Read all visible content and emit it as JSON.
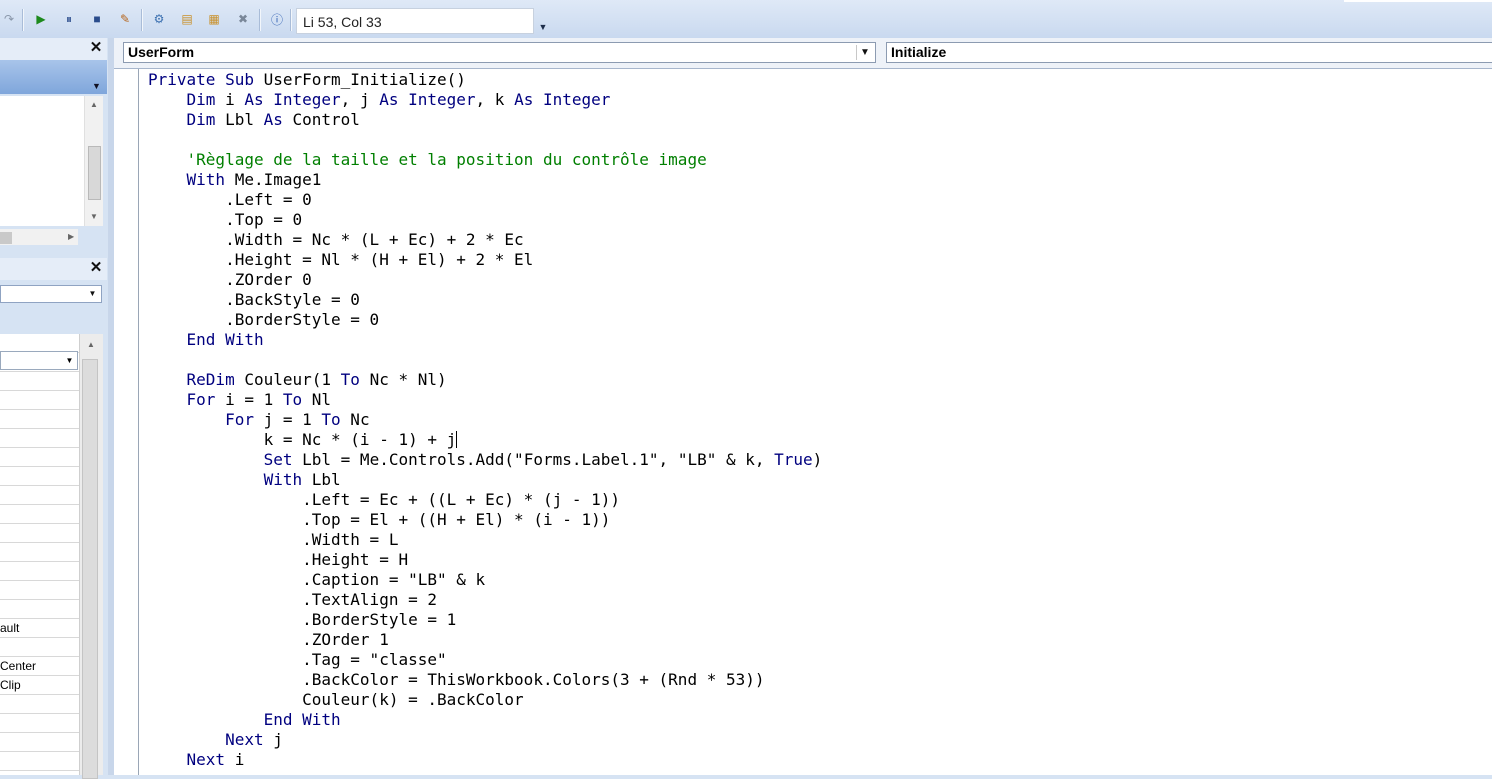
{
  "toolbar": {
    "icons": [
      "redo-icon",
      "run-icon",
      "pause-icon",
      "stop-icon",
      "design-mode-icon",
      "project-explorer-icon",
      "properties-window-icon",
      "object-browser-icon",
      "toolbox-icon",
      "help-icon"
    ],
    "cursor_position": "Li 53, Col 33"
  },
  "left_panel": {
    "property_rows": [
      "",
      "",
      "",
      "",
      "",
      "",
      "",
      "",
      "",
      "",
      "",
      "",
      "",
      "",
      "",
      "ault",
      "",
      "Center",
      "Clip",
      "",
      "",
      "",
      ""
    ]
  },
  "code_window": {
    "object_combo": "UserForm",
    "procedure_combo": "Initialize",
    "lines": [
      [
        [
          "Private Sub",
          "kw"
        ],
        [
          " UserForm_Initialize()",
          ""
        ]
      ],
      [
        [
          "    ",
          ""
        ],
        [
          "Dim",
          "kw"
        ],
        [
          " i ",
          ""
        ],
        [
          "As Integer",
          "kw"
        ],
        [
          ", j ",
          ""
        ],
        [
          "As Integer",
          "kw"
        ],
        [
          ", k ",
          ""
        ],
        [
          "As Integer",
          "kw"
        ]
      ],
      [
        [
          "    ",
          ""
        ],
        [
          "Dim",
          "kw"
        ],
        [
          " Lbl ",
          ""
        ],
        [
          "As",
          "kw"
        ],
        [
          " Control",
          ""
        ]
      ],
      [
        [
          "",
          ""
        ]
      ],
      [
        [
          "    ",
          ""
        ],
        [
          "'Règlage de la taille et la position du contrôle image",
          "cm"
        ]
      ],
      [
        [
          "    ",
          ""
        ],
        [
          "With",
          "kw"
        ],
        [
          " Me.Image1",
          ""
        ]
      ],
      [
        [
          "        .Left = 0",
          ""
        ]
      ],
      [
        [
          "        .Top = 0",
          ""
        ]
      ],
      [
        [
          "        .Width = Nc * (L + Ec) + 2 * Ec",
          ""
        ]
      ],
      [
        [
          "        .Height = Nl * (H + El) + 2 * El",
          ""
        ]
      ],
      [
        [
          "        .ZOrder 0",
          ""
        ]
      ],
      [
        [
          "        .BackStyle = 0",
          ""
        ]
      ],
      [
        [
          "        .BorderStyle = 0",
          ""
        ]
      ],
      [
        [
          "    ",
          ""
        ],
        [
          "End With",
          "kw"
        ]
      ],
      [
        [
          "",
          ""
        ]
      ],
      [
        [
          "    ",
          ""
        ],
        [
          "ReDim",
          "kw"
        ],
        [
          " Couleur(1 ",
          ""
        ],
        [
          "To",
          "kw"
        ],
        [
          " Nc * Nl)",
          ""
        ]
      ],
      [
        [
          "    ",
          ""
        ],
        [
          "For",
          "kw"
        ],
        [
          " i = 1 ",
          ""
        ],
        [
          "To",
          "kw"
        ],
        [
          " Nl",
          ""
        ]
      ],
      [
        [
          "        ",
          ""
        ],
        [
          "For",
          "kw"
        ],
        [
          " j = 1 ",
          ""
        ],
        [
          "To",
          "kw"
        ],
        [
          " Nc",
          ""
        ]
      ],
      [
        [
          "            k = Nc * (i - 1) + j",
          ""
        ],
        [
          "",
          "caret"
        ]
      ],
      [
        [
          "            ",
          ""
        ],
        [
          "Set",
          "kw"
        ],
        [
          " Lbl = Me.Controls.Add(\"Forms.Label.1\", \"LB\" & k, ",
          ""
        ],
        [
          "True",
          "kw"
        ],
        [
          ")",
          ""
        ]
      ],
      [
        [
          "            ",
          ""
        ],
        [
          "With",
          "kw"
        ],
        [
          " Lbl",
          ""
        ]
      ],
      [
        [
          "                .Left = Ec + ((L + Ec) * (j - 1))",
          ""
        ]
      ],
      [
        [
          "                .Top = El + ((H + El) * (i - 1))",
          ""
        ]
      ],
      [
        [
          "                .Width = L",
          ""
        ]
      ],
      [
        [
          "                .Height = H",
          ""
        ]
      ],
      [
        [
          "                .Caption = \"LB\" & k",
          ""
        ]
      ],
      [
        [
          "                .TextAlign = 2",
          ""
        ]
      ],
      [
        [
          "                .BorderStyle = 1",
          ""
        ]
      ],
      [
        [
          "                .ZOrder 1",
          ""
        ]
      ],
      [
        [
          "                .Tag = \"classe\"",
          ""
        ]
      ],
      [
        [
          "                .BackColor = ThisWorkbook.Colors(3 + (Rnd * 53))",
          ""
        ]
      ],
      [
        [
          "                Couleur(k) = .BackColor",
          ""
        ]
      ],
      [
        [
          "            ",
          ""
        ],
        [
          "End With",
          "kw"
        ]
      ],
      [
        [
          "        ",
          ""
        ],
        [
          "Next",
          "kw"
        ],
        [
          " j",
          ""
        ]
      ],
      [
        [
          "    ",
          ""
        ],
        [
          "Next",
          "kw"
        ],
        [
          " i",
          ""
        ]
      ]
    ]
  }
}
